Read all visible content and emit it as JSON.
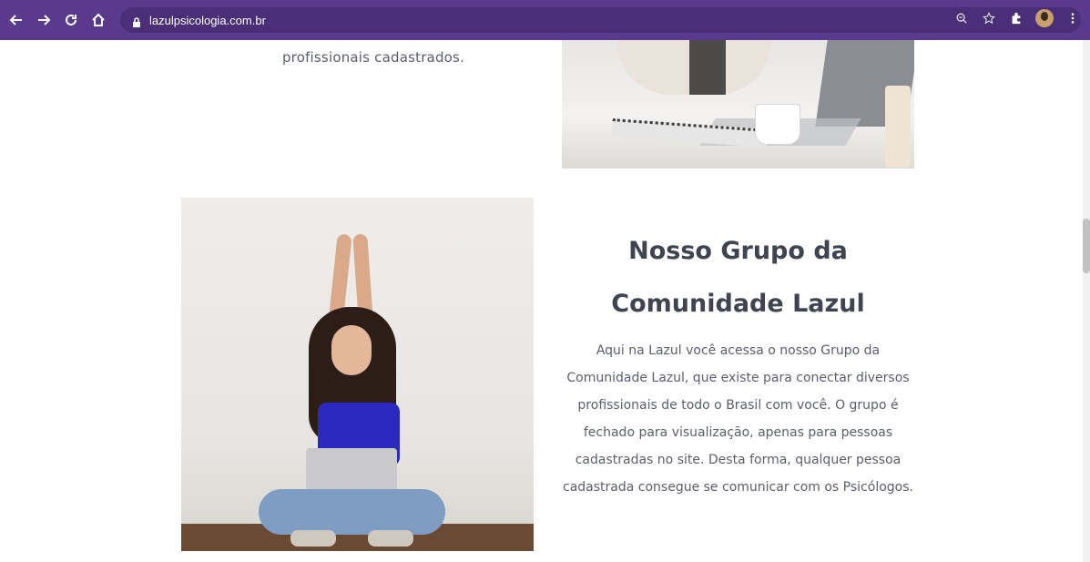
{
  "browser": {
    "url": "lazulpsicologia.com.br",
    "icons": [
      "back-arrow-icon",
      "forward-arrow-icon",
      "reload-icon",
      "home-icon",
      "lock-icon",
      "zoom-icon",
      "star-icon",
      "extensions-icon",
      "avatar",
      "menu-dots-icon"
    ]
  },
  "content": {
    "top_text": "profissionais cadastrados.",
    "section": {
      "title": "Nosso Grupo da Comunidade Lazul",
      "body": "Aqui na Lazul você acessa o nosso Grupo da Comunidade Lazul, que existe para conectar diversos profissionais de todo o Brasil com você. O grupo é fechado para visualização, apenas para pessoas cadastradas no site. Desta forma, qualquer pessoa cadastrada consegue se comunicar com os Psicólogos."
    }
  },
  "colors": {
    "browser_bar": "#5a3a8c",
    "title_text": "#3f4450",
    "body_text": "#5b5f69"
  }
}
